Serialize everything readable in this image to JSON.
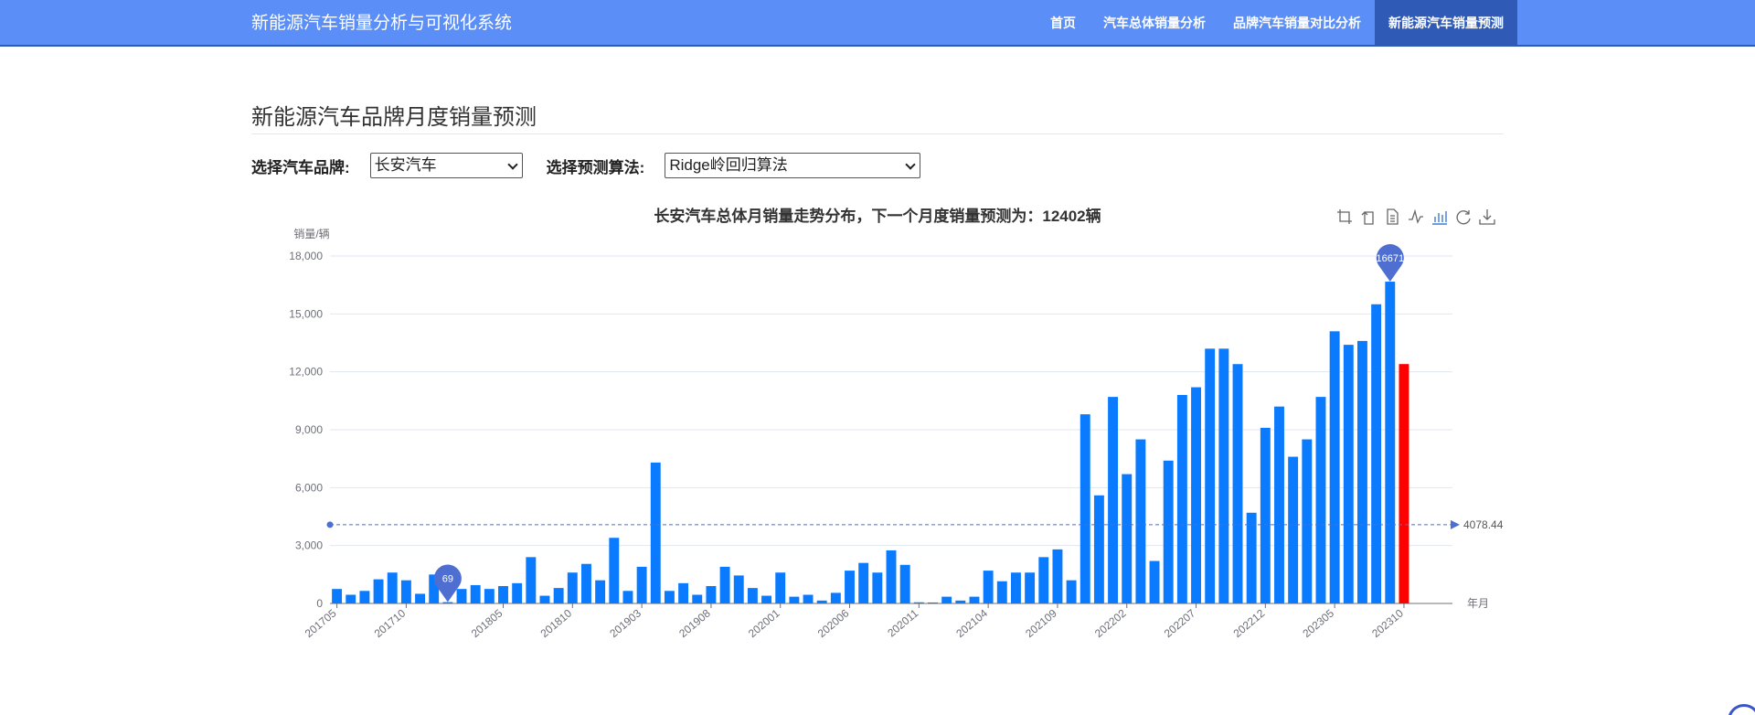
{
  "navbar": {
    "brand": "新能源汽车销量分析与可视化系统",
    "items": [
      {
        "label": "首页",
        "active": false
      },
      {
        "label": "汽车总体销量分析",
        "active": false
      },
      {
        "label": "品牌汽车销量对比分析",
        "active": false
      },
      {
        "label": "新能源汽车销量预测",
        "active": true
      }
    ],
    "bg_color": "#5b8ef6",
    "active_color": "#2f5bb7"
  },
  "page": {
    "title": "新能源汽车品牌月度销量预测"
  },
  "controls": {
    "brand_label": "选择汽车品牌:",
    "brand_value": "长安汽车",
    "algo_label": "选择预测算法:",
    "algo_value": "Ridge岭回归算法"
  },
  "toolbox": {
    "icons": [
      "zoom-icon",
      "zoom-reset-icon",
      "data-view-icon",
      "line-chart-icon",
      "bar-chart-icon",
      "restore-icon",
      "download-icon"
    ]
  },
  "chart_data": {
    "type": "bar",
    "title": "长安汽车总体月销量走势分布，下一个月度销量预测为：12402辆",
    "ylabel": "销量/辆",
    "xlabel": "年月",
    "ylim": [
      0,
      18000
    ],
    "yticks": [
      "0",
      "3,000",
      "6,000",
      "9,000",
      "12,000",
      "15,000",
      "18,000"
    ],
    "ytick_values": [
      0,
      3000,
      6000,
      9000,
      12000,
      15000,
      18000
    ],
    "categories": [
      "201705",
      "201706",
      "201707",
      "201708",
      "201709",
      "201710",
      "201711",
      "201712",
      "201801",
      "201802",
      "201803",
      "201804",
      "201805",
      "201806",
      "201807",
      "201808",
      "201809",
      "201810",
      "201811",
      "201812",
      "201901",
      "201902",
      "201903",
      "201904",
      "201905",
      "201906",
      "201907",
      "201908",
      "201909",
      "201910",
      "201911",
      "201912",
      "202001",
      "202002",
      "202003",
      "202004",
      "202005",
      "202006",
      "202007",
      "202008",
      "202009",
      "202010",
      "202011",
      "202012",
      "202101",
      "202102",
      "202103",
      "202104",
      "202105",
      "202106",
      "202107",
      "202108",
      "202109",
      "202110",
      "202111",
      "202112",
      "202201",
      "202202",
      "202203",
      "202204",
      "202205",
      "202206",
      "202207",
      "202208",
      "202209",
      "202210",
      "202211",
      "202212",
      "202301",
      "202302",
      "202303",
      "202304",
      "202305",
      "202306",
      "202307",
      "202308",
      "202309",
      "202310",
      "202311",
      "202312",
      "202401"
    ],
    "xtick_labels": [
      "201705",
      "201710",
      "201805",
      "201810",
      "201903",
      "201908",
      "202001",
      "202006",
      "202011",
      "202104",
      "202109",
      "202202",
      "202207",
      "202212",
      "202305",
      "202310"
    ],
    "values": [
      750,
      450,
      650,
      1250,
      1600,
      1200,
      500,
      1500,
      69,
      750,
      950,
      750,
      900,
      1050,
      2400,
      400,
      800,
      1600,
      2050,
      1200,
      3400,
      650,
      1900,
      7300,
      650,
      1050,
      450,
      900,
      1900,
      1450,
      800,
      400,
      1600,
      350,
      450,
      150,
      550,
      1700,
      2100,
      1600,
      2750,
      2000,
      60,
      50,
      350,
      150,
      350,
      1700,
      1150,
      1600,
      1600,
      2400,
      2800,
      1200,
      9800,
      5600,
      10700,
      6700,
      8500,
      2200,
      7400,
      10800,
      11200,
      13200,
      13200,
      12400,
      4700,
      9100,
      10200,
      7600,
      8500,
      10700,
      14100,
      13400,
      13600,
      15500,
      16671,
      12402
    ],
    "predicted_index": 77,
    "bar_color": "#0a7bff",
    "predicted_color": "#ff0000",
    "mark_points": {
      "max": {
        "index": 76,
        "label": "16671"
      },
      "min": {
        "index": 8,
        "label": "69"
      }
    },
    "mark_line": {
      "label": "4078.44",
      "value": 4078.44
    },
    "mark_color": "#4e6fd1"
  }
}
